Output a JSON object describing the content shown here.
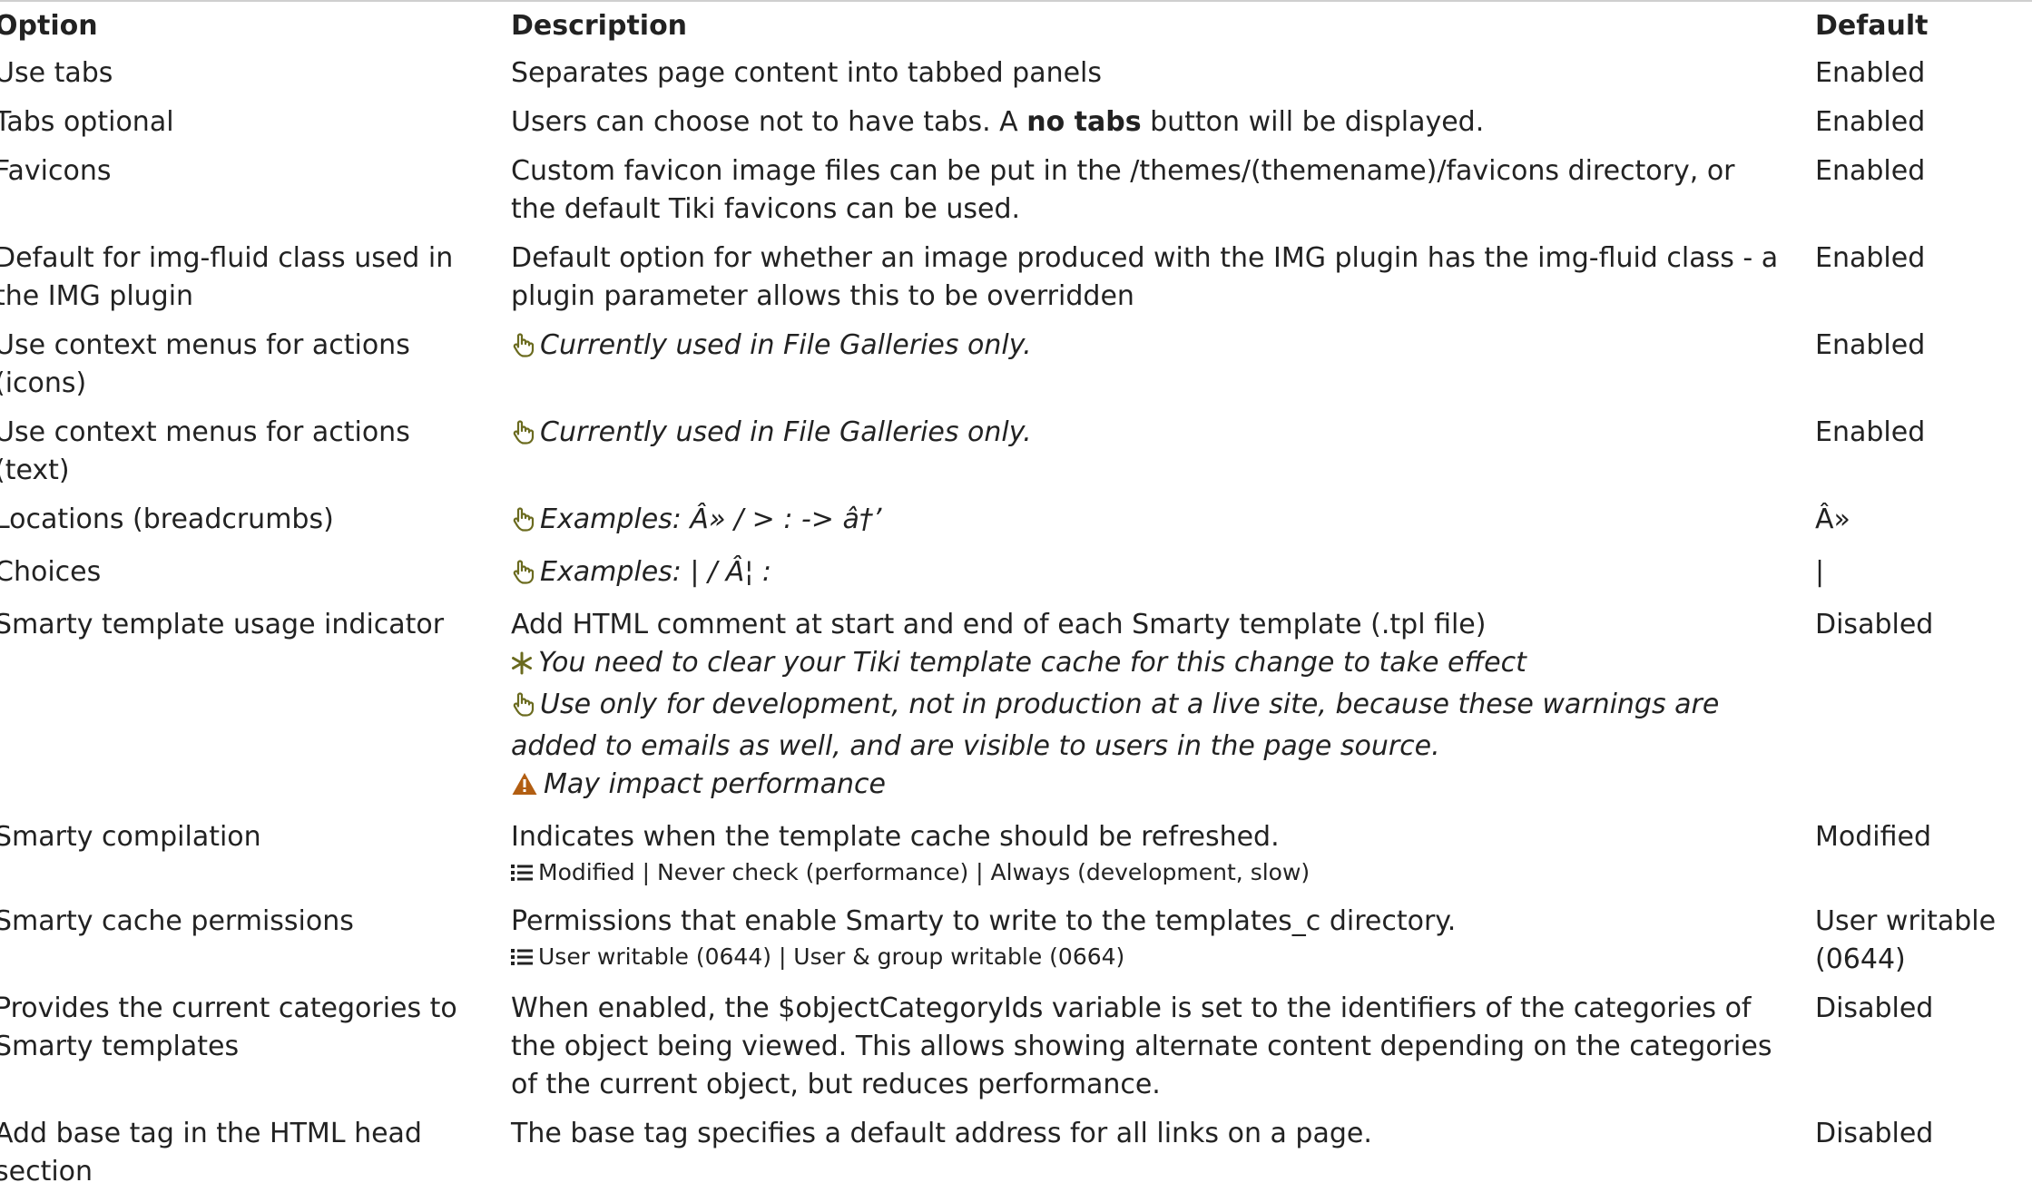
{
  "table": {
    "headers": {
      "option": "Option",
      "description": "Description",
      "default": "Default"
    },
    "rows": [
      {
        "option": "Use tabs",
        "description": "Separates page content into tabbed panels",
        "default": "Enabled"
      },
      {
        "option": "Tabs optional",
        "description_before": "Users can choose not to have tabs. A ",
        "description_bold": "no tabs",
        "description_after": " button will be displayed.",
        "default": "Enabled"
      },
      {
        "option": "Favicons",
        "description": "Custom favicon image files can be put in the /themes/(themename)/favicons directory, or the default Tiki favicons can be used.",
        "default": "Enabled"
      },
      {
        "option": "Default for img-fluid class used in the IMG plugin",
        "description": "Default option for whether an image produced with the IMG plugin has the img-fluid class - a plugin parameter allows this to be overridden",
        "default": "Enabled"
      },
      {
        "option": "Use context menus for actions (icons)",
        "tip": "Currently used in File Galleries only.",
        "default": "Enabled"
      },
      {
        "option": "Use context menus for actions (text)",
        "tip": "Currently used in File Galleries only.",
        "default": "Enabled"
      },
      {
        "option": "Locations (breadcrumbs)",
        "tip": "Examples: Â» / > : -> â†’",
        "default": "Â»"
      },
      {
        "option": "Choices",
        "tip": "Examples: | / Â¦ :",
        "default": "|"
      },
      {
        "option": "Smarty template usage indicator",
        "description": "Add HTML comment at start and end of each Smarty template (.tpl file)",
        "note_cache": "You need to clear your Tiki template cache for this change to take effect",
        "tip": "Use only for development, not in production at a live site, because these warnings are added to emails as well, and are visible to users in the page source.",
        "warning": "May impact performance",
        "default": "Disabled"
      },
      {
        "option": "Smarty compilation",
        "description": "Indicates when the template cache should be refreshed.",
        "options_list": "Modified | Never check (performance) | Always (development, slow)",
        "default": "Modified"
      },
      {
        "option": "Smarty cache permissions",
        "description": "Permissions that enable Smarty to write to the templates_c directory.",
        "options_list": "User writable (0644) | User & group writable (0664)",
        "default": "User writable (0644)"
      },
      {
        "option": "Provides the current categories to Smarty templates",
        "description": "When enabled, the $objectCategoryIds variable is set to the identifiers of the categories of the object being viewed. This allows showing alternate content depending on the categories of the current object, but reduces performance.",
        "default": "Disabled"
      },
      {
        "option": "Add base tag in the HTML head section",
        "description": "The base tag specifies a default address for all links on a page.",
        "default": "Disabled"
      }
    ]
  },
  "icons": {
    "tip": "hand-pointer-icon",
    "note": "asterisk-icon",
    "warning": "warning-triangle-icon",
    "list": "list-icon"
  },
  "colors": {
    "tip_icon": "#6b6b1f",
    "note_icon": "#6b6b1f",
    "warning_icon": "#b25e12",
    "text": "#222222"
  }
}
